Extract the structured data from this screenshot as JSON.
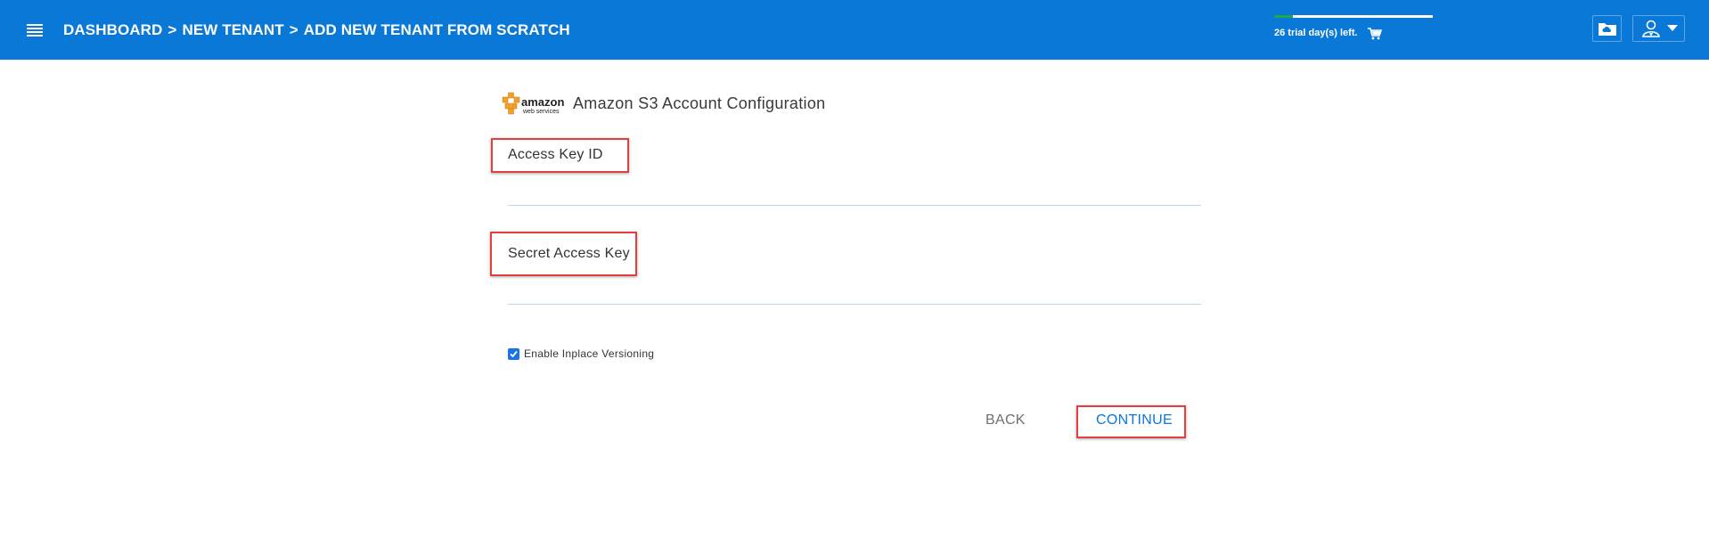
{
  "header": {
    "breadcrumb": [
      "DASHBOARD",
      "NEW TENANT",
      "ADD NEW TENANT FROM SCRATCH"
    ],
    "breadcrumb_separator": ">",
    "trial_text": "26 trial day(s) left.",
    "trial_progress_fraction": 0.12,
    "icons": {
      "menu": "hamburger-menu-icon",
      "cart": "shopping-cart-icon",
      "folder": "cloud-folder-icon",
      "user": "user-account-icon"
    }
  },
  "form": {
    "logo": {
      "text_main": "amazon",
      "text_sub": "web services"
    },
    "title": "Amazon S3 Account Configuration",
    "fields": [
      {
        "label": "Access Key ID",
        "value": ""
      },
      {
        "label": "Secret Access Key",
        "value": ""
      }
    ],
    "versioning": {
      "label": "Enable Inplace Versioning",
      "checked": true
    },
    "back_label": "BACK",
    "continue_label": "CONTINUE"
  },
  "colors": {
    "header_bg": "#0a78d6",
    "highlight": "#e2403f",
    "primary_text": "#0a78d6",
    "aws_orange": "#f4a021"
  }
}
